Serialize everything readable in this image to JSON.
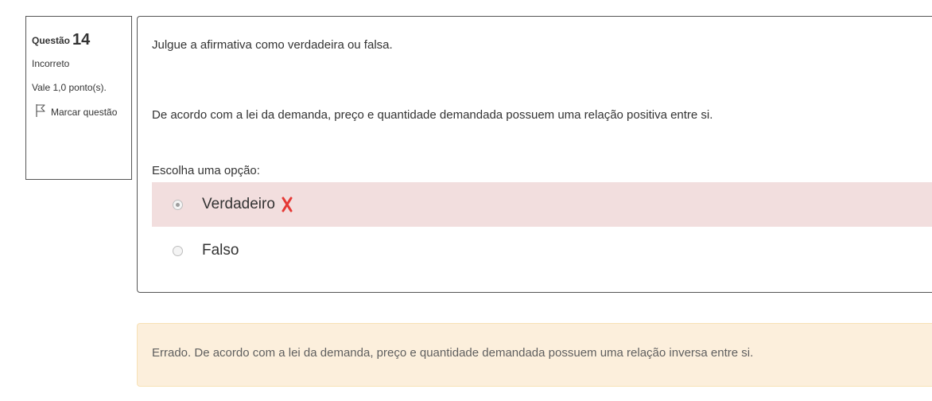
{
  "question_info": {
    "label": "Questão",
    "number": "14",
    "state": "Incorreto",
    "grade": "Vale 1,0 ponto(s).",
    "flag_label": "Marcar questão",
    "flag_icon": "flag-icon"
  },
  "question": {
    "instruction": "Julgue a afirmativa como verdadeira ou falsa.",
    "statement": "De acordo com a lei da demanda, preço e quantidade demandada possuem uma relação positiva entre si.",
    "prompt": "Escolha uma opção:",
    "options": [
      {
        "label": "Verdadeiro",
        "selected": true,
        "status": "incorrect",
        "status_icon": "cross-icon"
      },
      {
        "label": "Falso",
        "selected": false
      }
    ]
  },
  "feedback": {
    "text": "Errado. De acordo com a lei da demanda, preço e quantidade demandada possuem uma relação inversa entre si."
  },
  "colors": {
    "incorrect_background": "#f2dede",
    "incorrect_icon": "#e53935",
    "feedback_background": "#fcefdc",
    "border": "#555555"
  }
}
